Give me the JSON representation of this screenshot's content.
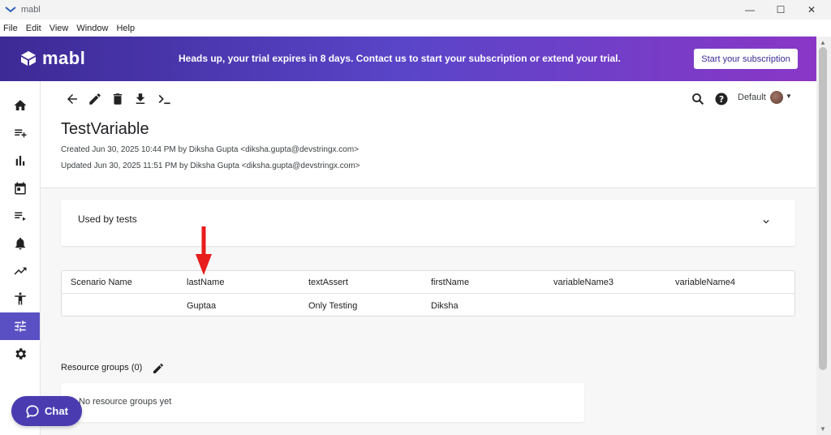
{
  "window": {
    "title": "mabl",
    "minimize": "—",
    "maximize": "☐",
    "close": "✕"
  },
  "menu": [
    "File",
    "Edit",
    "View",
    "Window",
    "Help"
  ],
  "banner": {
    "brand": "mabl",
    "notice": "Heads up, your trial expires in 8 days. Contact us to start your subscription or extend your trial.",
    "subscribe_label": "Start your subscription"
  },
  "sidebar": {
    "items": [
      {
        "icon": "home-icon"
      },
      {
        "icon": "playlist-add-icon"
      },
      {
        "icon": "bar-chart-icon"
      },
      {
        "icon": "calendar-icon"
      },
      {
        "icon": "playlist-play-icon"
      },
      {
        "icon": "bell-icon"
      },
      {
        "icon": "trending-up-icon"
      },
      {
        "icon": "accessibility-icon"
      },
      {
        "icon": "tune-icon",
        "active": true
      },
      {
        "icon": "gear-icon"
      }
    ]
  },
  "toolbar": {
    "environment": "Default"
  },
  "page": {
    "title": "TestVariable",
    "created": "Created Jun 30, 2025 10:44 PM by Diksha Gupta <diksha.gupta@devstringx.com>",
    "updated": "Updated Jun 30, 2025 11:51 PM by Diksha Gupta <diksha.gupta@devstringx.com>"
  },
  "used_by_tests": {
    "label": "Used by tests"
  },
  "table": {
    "headers": [
      "Scenario Name",
      "lastName",
      "textAssert",
      "firstName",
      "variableName3",
      "variableName4"
    ],
    "rows": [
      [
        "",
        "Guptaa",
        "Only Testing",
        "Diksha",
        "",
        ""
      ]
    ]
  },
  "resource_groups": {
    "title": "Resource groups (0)",
    "empty_message": "No resource groups yet"
  },
  "chat": {
    "label": "Chat"
  },
  "colors": {
    "accent": "#5b4fc4",
    "banner_start": "#3d2a95",
    "banner_end": "#8a37c6",
    "annotation": "#e81d1d"
  }
}
